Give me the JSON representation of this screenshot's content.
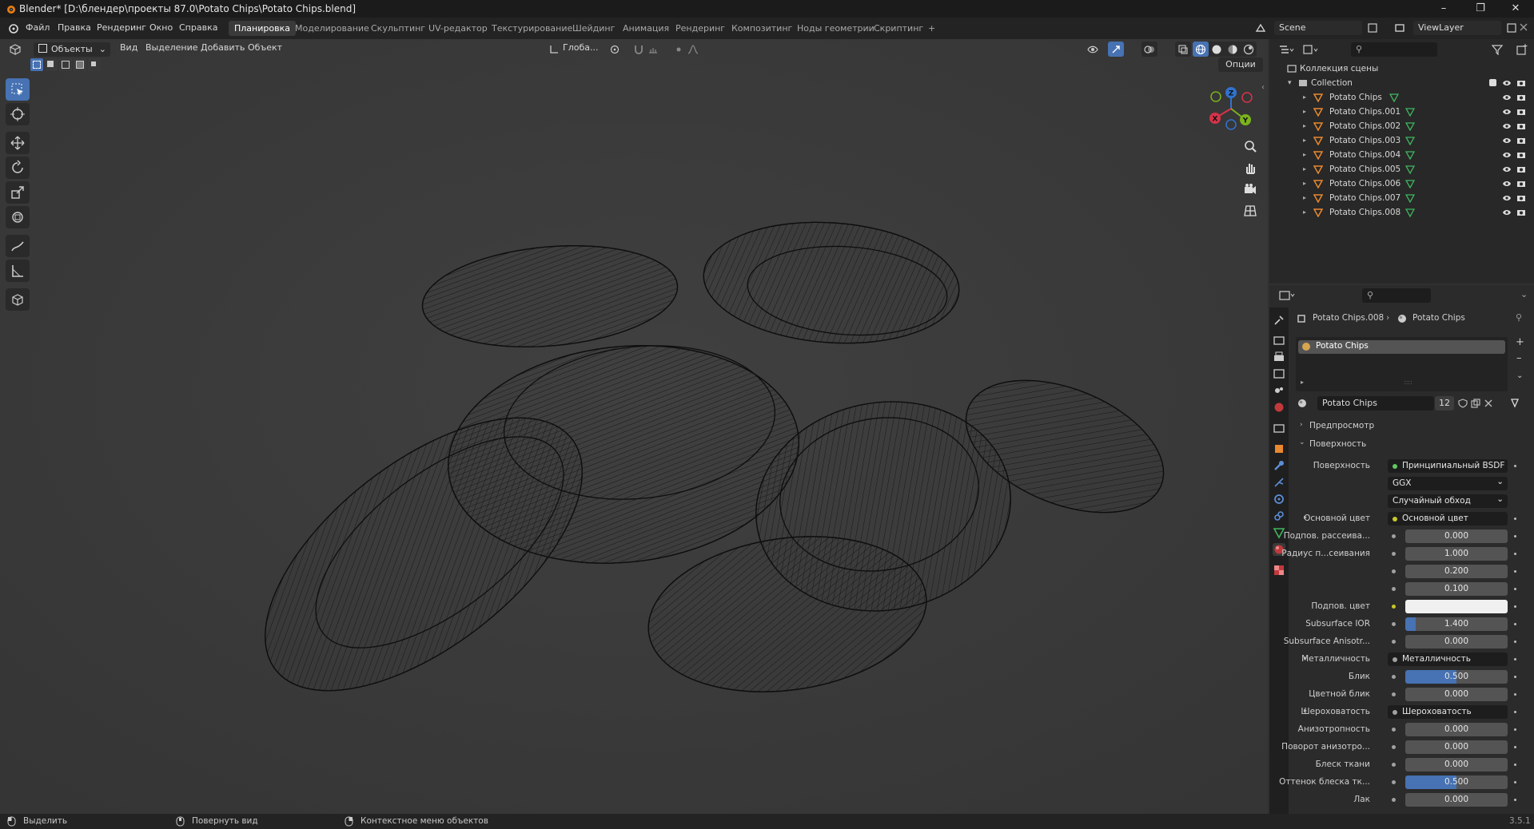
{
  "window": {
    "title": "Blender* [D:\\блендер\\проекты 87.0\\Potato Chips\\Potato Chips.blend]"
  },
  "menu": [
    "Файл",
    "Правка",
    "Рендеринг",
    "Окно",
    "Справка"
  ],
  "workspaces": [
    "Планировка",
    "Моделирование",
    "Скульптинг",
    "UV-редактор",
    "Текстурирование",
    "Шейдинг",
    "Анимация",
    "Рендеринг",
    "Композитинг",
    "Ноды геометрии",
    "Скриптинг",
    "+"
  ],
  "active_workspace": "Планировка",
  "scene": {
    "name": "Scene",
    "view_layer": "ViewLayer"
  },
  "viewport": {
    "mode": "Объекты",
    "menus": [
      "Вид",
      "Выделение",
      "Добавить",
      "Объект"
    ],
    "orientation": "Глоба...",
    "options_label": "Опции",
    "gizmo": {
      "x": "X",
      "y": "Y",
      "z": "Z"
    }
  },
  "outliner": {
    "root": "Коллекция сцены",
    "collection": "Collection",
    "items": [
      "Potato Chips",
      "Potato Chips.001",
      "Potato Chips.002",
      "Potato Chips.003",
      "Potato Chips.004",
      "Potato Chips.005",
      "Potato Chips.006",
      "Potato Chips.007",
      "Potato Chips.008"
    ]
  },
  "properties": {
    "breadcrumb_object": "Potato Chips.008",
    "breadcrumb_material": "Potato Chips",
    "slot_name": "Potato Chips",
    "material_name": "Potato Chips",
    "user_count": "12",
    "panel_preview": "Предпросмотр",
    "panel_surface": "Поверхность",
    "rows": [
      {
        "label": "Поверхность",
        "type": "node",
        "value": "Принципиальный BSDF",
        "socket": "#63c763"
      },
      {
        "label": "",
        "type": "dropdown",
        "value": "GGX"
      },
      {
        "label": "",
        "type": "dropdown",
        "value": "Случайный обход"
      },
      {
        "label": "Основной цвет",
        "type": "node",
        "value": "Основной цвет",
        "socket": "#c7c729",
        "expand": true
      },
      {
        "label": "Подпов. рассеива...",
        "type": "num",
        "value": "0.000",
        "fill": 0
      },
      {
        "label": "Радиус п...сеивания",
        "type": "num",
        "value": "1.000",
        "fill": 0
      },
      {
        "label": "",
        "type": "num",
        "value": "0.200",
        "fill": 0
      },
      {
        "label": "",
        "type": "num",
        "value": "0.100",
        "fill": 0
      },
      {
        "label": "Подпов. цвет",
        "type": "color",
        "value": "",
        "color": "#f0f0f0",
        "socket": "#c7c729"
      },
      {
        "label": "Subsurface IOR",
        "type": "num",
        "value": "1.400",
        "fill": 0.1
      },
      {
        "label": "Subsurface Anisotr...",
        "type": "num",
        "value": "0.000",
        "fill": 0
      },
      {
        "label": "Металличность",
        "type": "node",
        "value": "Металличность",
        "socket": "#a1a1a1",
        "expand": true
      },
      {
        "label": "Блик",
        "type": "num",
        "value": "0.500",
        "fill": 0.5
      },
      {
        "label": "Цветной блик",
        "type": "num",
        "value": "0.000",
        "fill": 0
      },
      {
        "label": "Шероховатость",
        "type": "node",
        "value": "Шероховатость",
        "socket": "#a1a1a1",
        "expand": true
      },
      {
        "label": "Анизотропность",
        "type": "num",
        "value": "0.000",
        "fill": 0
      },
      {
        "label": "Поворот анизотро...",
        "type": "num",
        "value": "0.000",
        "fill": 0
      },
      {
        "label": "Блеск ткани",
        "type": "num",
        "value": "0.000",
        "fill": 0
      },
      {
        "label": "Оттенок блеска тк...",
        "type": "num",
        "value": "0.500",
        "fill": 0.5
      },
      {
        "label": "Лак",
        "type": "num",
        "value": "0.000",
        "fill": 0
      }
    ]
  },
  "statusbar": {
    "select": "Выделить",
    "rotate": "Повернуть вид",
    "context": "Контекстное меню объектов",
    "version": "3.5.1"
  },
  "colors": {
    "accent": "#4772b3",
    "selection": "#334d80",
    "header": "#232323",
    "viewport": "#3c3c3c",
    "wire": "#0f0f0f"
  }
}
